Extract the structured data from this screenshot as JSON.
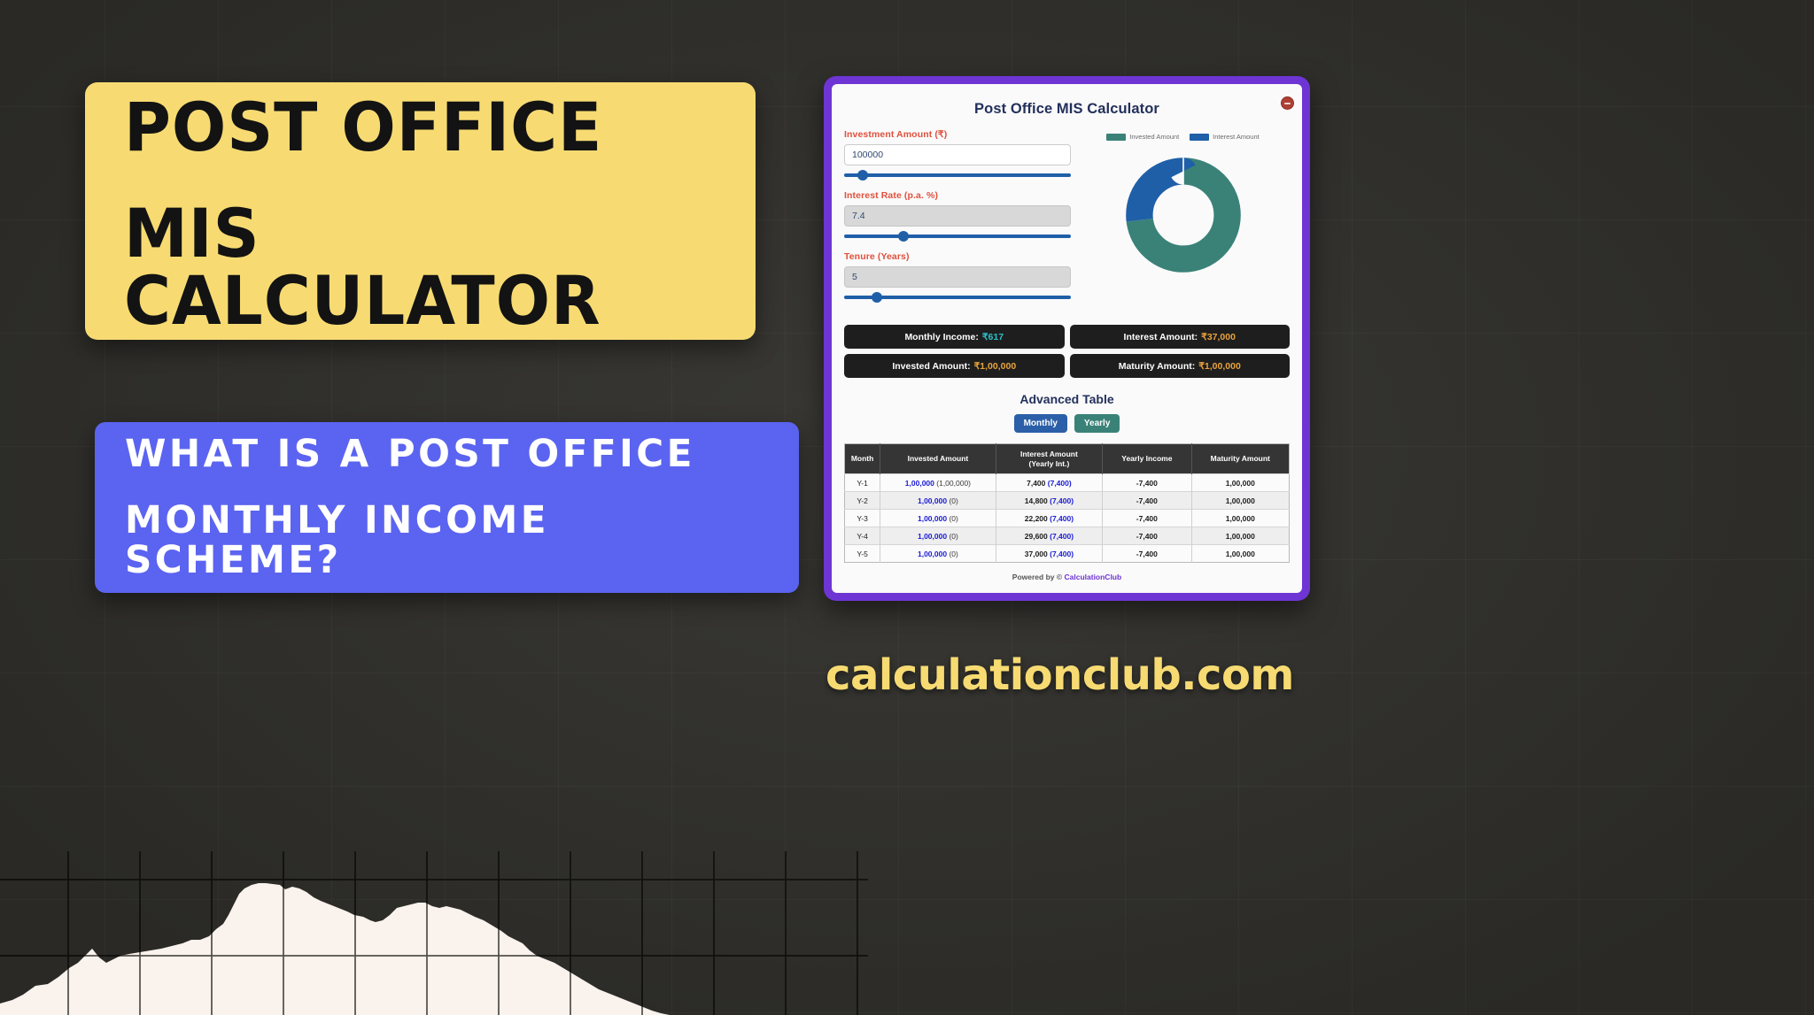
{
  "background": {
    "color": "#33322e",
    "grid": true
  },
  "title_card": {
    "bg_color": "#f7db72",
    "line1": "POST OFFICE",
    "line2": "MIS CALCULATOR"
  },
  "question_card": {
    "bg_color": "#5b64f0",
    "line1": "WHAT IS A POST OFFICE",
    "line2": "MONTHLY INCOME SCHEME?"
  },
  "site_url": "calculationclub.com",
  "calculator": {
    "frame_color": "#6e35d4",
    "title": "Post Office MIS Calculator",
    "close_icon": "minus-circle-icon",
    "fields": [
      {
        "label": "Investment Amount (₹)",
        "value": "100000",
        "disabled": false,
        "slider_percent": 6
      },
      {
        "label": "Interest Rate (p.a. %)",
        "value": "7.4",
        "disabled": true,
        "slider_percent": 24
      },
      {
        "label": "Tenure (Years)",
        "value": "5",
        "disabled": true,
        "slider_percent": 12
      }
    ],
    "chart_data": {
      "type": "pie",
      "title": "",
      "labels": [
        "Invested Amount",
        "Interest Amount"
      ],
      "values": [
        100000,
        37000
      ],
      "percents": [
        73,
        27
      ],
      "colors": [
        "#3a8278",
        "#1f5fa8"
      ],
      "legend_position": "top",
      "donut": true,
      "inner_radius_ratio": 0.55
    },
    "results": [
      {
        "label": "Monthly Income:",
        "value": "₹617",
        "value_color": "#2bc0c8"
      },
      {
        "label": "Interest Amount:",
        "value": "₹37,000",
        "value_color": "#e8a33d"
      },
      {
        "label": "Invested Amount:",
        "value": "₹1,00,000",
        "value_color": "#e8a33d"
      },
      {
        "label": "Maturity Amount:",
        "value": "₹1,00,000",
        "value_color": "#e8a33d"
      }
    ],
    "advanced_table": {
      "heading": "Advanced Table",
      "toggle": {
        "monthly": "Monthly",
        "yearly": "Yearly",
        "active": "Monthly"
      },
      "columns": [
        "Month",
        "Invested Amount",
        "Interest Amount\n(Yearly Int.)",
        "Yearly Income",
        "Maturity Amount"
      ],
      "column_header_lines": [
        [
          "Month"
        ],
        [
          "Invested Amount"
        ],
        [
          "Interest Amount",
          "(Yearly Int.)"
        ],
        [
          "Yearly Income"
        ],
        [
          "Maturity Amount"
        ]
      ],
      "rows": [
        {
          "month": "Y-1",
          "invested_main": "1,00,000",
          "invested_sub": "(1,00,000)",
          "interest_main": "7,400",
          "interest_sub": "(7,400)",
          "yearly_income": "-7,400",
          "maturity": "1,00,000"
        },
        {
          "month": "Y-2",
          "invested_main": "1,00,000",
          "invested_sub": "(0)",
          "interest_main": "14,800",
          "interest_sub": "(7,400)",
          "yearly_income": "-7,400",
          "maturity": "1,00,000"
        },
        {
          "month": "Y-3",
          "invested_main": "1,00,000",
          "invested_sub": "(0)",
          "interest_main": "22,200",
          "interest_sub": "(7,400)",
          "yearly_income": "-7,400",
          "maturity": "1,00,000"
        },
        {
          "month": "Y-4",
          "invested_main": "1,00,000",
          "invested_sub": "(0)",
          "interest_main": "29,600",
          "interest_sub": "(7,400)",
          "yearly_income": "-7,400",
          "maturity": "1,00,000"
        },
        {
          "month": "Y-5",
          "invested_main": "1,00,000",
          "invested_sub": "(0)",
          "interest_main": "37,000",
          "interest_sub": "(7,400)",
          "yearly_income": "-7,400",
          "maturity": "1,00,000"
        }
      ]
    },
    "footer": {
      "prefix": "Powered by ©",
      "brand": "CalculationClub"
    }
  }
}
